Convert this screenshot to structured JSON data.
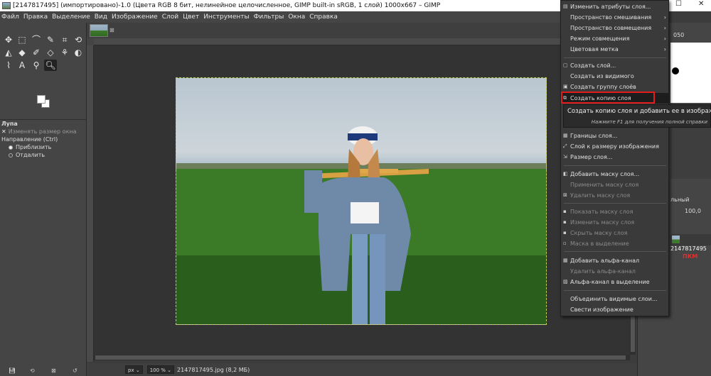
{
  "window": {
    "title": "[2147817495] (импортировано)-1.0 (Цвета RGB 8 бит, нелинейное целочисленное, GIMP built-in sRGB, 1 слой) 1000x667 – GIMP",
    "minimize": "—",
    "maximize": "☐",
    "close": "✕"
  },
  "menubar": [
    "Файл",
    "Правка",
    "Выделение",
    "Вид",
    "Изображение",
    "Слой",
    "Цвет",
    "Инструменты",
    "Фильтры",
    "Окна",
    "Справка"
  ],
  "tool_options": {
    "title": "Лупа",
    "resize_window": "Изменять размер окна",
    "direction_label": "Направление  (Ctrl)",
    "zoom_in": "Приблизить",
    "zoom_out": "Отдалить"
  },
  "statusbar": {
    "unit": "px",
    "zoom": "100 %",
    "file": "2147817495.jpg (8,2 МБ)"
  },
  "right_dock": {
    "value_top": "050",
    "mode_label": "льный",
    "opacity": "100,0",
    "layer_name": "2147817495"
  },
  "context_menu": {
    "items": [
      {
        "label": "Изменить атрибуты слоя...",
        "enabled": true,
        "submenu": false,
        "icon": "edit-icon"
      },
      {
        "label": "Пространство смешивания",
        "enabled": true,
        "submenu": true,
        "icon": ""
      },
      {
        "label": "Пространство совмещения",
        "enabled": true,
        "submenu": true,
        "icon": ""
      },
      {
        "label": "Режим совмещения",
        "enabled": true,
        "submenu": true,
        "icon": ""
      },
      {
        "label": "Цветовая метка",
        "enabled": true,
        "submenu": true,
        "icon": ""
      },
      {
        "label": "Создать слой...",
        "enabled": true,
        "submenu": false,
        "icon": "new-layer-icon"
      },
      {
        "label": "Создать из видимого",
        "enabled": true,
        "submenu": false,
        "icon": ""
      },
      {
        "label": "Создать группу слоёв",
        "enabled": true,
        "submenu": false,
        "icon": "group-icon"
      },
      {
        "label": "Создать копию слоя",
        "enabled": true,
        "submenu": false,
        "icon": "duplicate-icon"
      },
      {
        "label": "Границы слоя...",
        "enabled": true,
        "submenu": false,
        "icon": "boundary-icon"
      },
      {
        "label": "Слой к размеру изображения",
        "enabled": true,
        "submenu": false,
        "icon": "fit-icon"
      },
      {
        "label": "Размер слоя...",
        "enabled": true,
        "submenu": false,
        "icon": "scale-icon"
      },
      {
        "label": "Добавить маску слоя...",
        "enabled": true,
        "submenu": false,
        "icon": "mask-add-icon"
      },
      {
        "label": "Применить маску слоя",
        "enabled": false,
        "submenu": false,
        "icon": ""
      },
      {
        "label": "Удалить маску слоя",
        "enabled": false,
        "submenu": false,
        "icon": "mask-delete-icon"
      },
      {
        "label": "Показать маску слоя",
        "enabled": false,
        "submenu": false,
        "icon": "checkbox-icon"
      },
      {
        "label": "Изменить маску слоя",
        "enabled": false,
        "submenu": false,
        "icon": "checkbox-icon"
      },
      {
        "label": "Скрыть маску слоя",
        "enabled": false,
        "submenu": false,
        "icon": "checkbox-icon"
      },
      {
        "label": "Маска в выделение",
        "enabled": false,
        "submenu": false,
        "icon": "selection-icon"
      },
      {
        "label": "Добавить альфа-канал",
        "enabled": true,
        "submenu": false,
        "icon": "alpha-add-icon"
      },
      {
        "label": "Удалить альфа-канал",
        "enabled": false,
        "submenu": false,
        "icon": ""
      },
      {
        "label": "Альфа-канал в выделение",
        "enabled": true,
        "submenu": false,
        "icon": "alpha-select-icon"
      },
      {
        "label": "Объединить видимые слои...",
        "enabled": true,
        "submenu": false,
        "icon": ""
      },
      {
        "label": "Свести изображение",
        "enabled": true,
        "submenu": false,
        "icon": ""
      }
    ]
  },
  "tooltip": {
    "text": "Создать копию слоя и добавить ее в изображение",
    "hint": "Нажмите F1 для получения полной справки"
  },
  "annotation": "ПКМ",
  "colors": {
    "highlight_box": "#e21c1c",
    "annotation": "#e03030"
  }
}
